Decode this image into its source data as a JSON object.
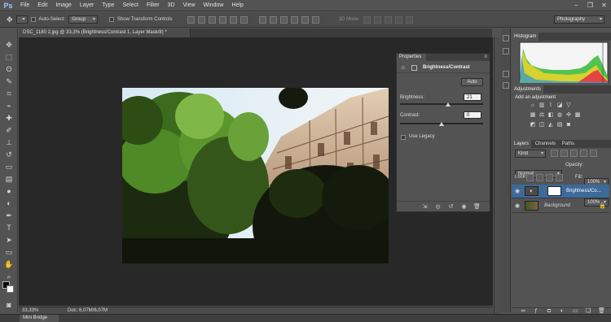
{
  "app": {
    "logo": "Ps"
  },
  "menu": [
    "File",
    "Edit",
    "Image",
    "Layer",
    "Type",
    "Select",
    "Filter",
    "3D",
    "View",
    "Window",
    "Help"
  ],
  "window_controls": [
    "−",
    "❐",
    "✕"
  ],
  "options_bar": {
    "auto_select_label": "Auto-Select:",
    "auto_select_value": "Group",
    "show_transform_label": "Show Transform Controls",
    "mode_3d_label": "3D Mode:",
    "workspace": "Photography"
  },
  "document": {
    "tab_title": "DSC_1180 2.jpg @ 33,3% (Brightness/Contrast 1, Layer Mask/8) *",
    "zoom": "33,33%",
    "doc_size": "Doc: 6,07M/6,07M"
  },
  "mini_bridge": "Mini Bridge",
  "properties": {
    "tab": "Properties",
    "title": "Brightness/Contrast",
    "auto_label": "Auto",
    "brightness_label": "Brightness:",
    "brightness_value": "21",
    "contrast_label": "Contrast:",
    "contrast_value": "0",
    "legacy_label": "Use Legacy",
    "brightness_fraction": 0.58,
    "contrast_fraction": 0.5
  },
  "histogram": {
    "tab": "Histogram"
  },
  "adjustments": {
    "tab": "Adjustments",
    "subtitle": "Add an adjustment"
  },
  "layers_panel": {
    "tabs": [
      "Layers",
      "Channels",
      "Paths"
    ],
    "kind_label": "Kind",
    "blend_mode": "Normal",
    "opacity_label": "Opacity:",
    "opacity_value": "100%",
    "lock_label": "Lock:",
    "fill_label": "Fill:",
    "fill_value": "100%",
    "layers": [
      {
        "name": "Brightness/Co...",
        "selected": true
      },
      {
        "name": "Background",
        "selected": false
      }
    ]
  },
  "colors": {
    "accent": "#9ec9ff",
    "panel": "#535353",
    "canvas": "#282828",
    "selection": "#3d6a99"
  }
}
